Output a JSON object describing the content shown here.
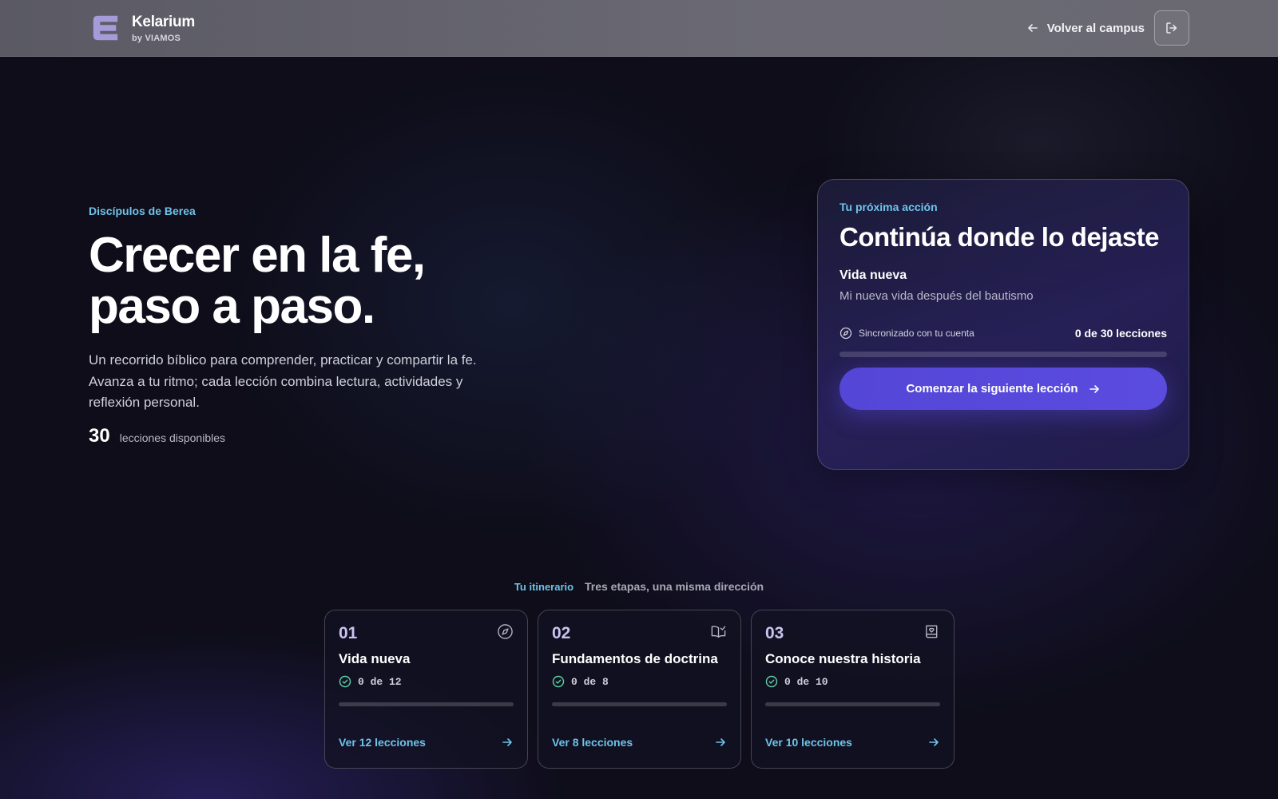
{
  "header": {
    "app_name": "Kelarium",
    "by_line": "by VIAMOS",
    "back_label": "Volver al campus",
    "logo_icon": "kelarium-logo",
    "logout_icon": "logout-icon"
  },
  "hero": {
    "eyebrow": "Discípulos de Berea",
    "title_line1": "Crecer en la fe,",
    "title_line2": "paso a paso.",
    "description": "Un recorrido bíblico para comprender, practicar y compartir la fe. Avanza a tu ritmo; cada lección combina lectura, actividades y reflexión personal.",
    "lessons_count": "30",
    "lessons_label": "lecciones disponibles"
  },
  "next_action": {
    "eyebrow": "Tu próxima acción",
    "title": "Continúa donde lo dejaste",
    "course_title": "Vida nueva",
    "course_subtitle": "Mi nueva vida después del bautismo",
    "sync_label": "Sincronizado con tu cuenta",
    "progress_label": "0 de 30 lecciones",
    "progress_fraction": 0,
    "cta_label": "Comenzar la siguiente lección"
  },
  "itinerary": {
    "label": "Tu itinerario",
    "subtitle": "Tres etapas, una misma dirección",
    "stages": [
      {
        "number": "01",
        "title": "Vida nueva",
        "count": "0 de 12",
        "progress_fraction": 0,
        "link": "Ver 12 lecciones",
        "icon": "compass-icon"
      },
      {
        "number": "02",
        "title": "Fundamentos de doctrina",
        "count": "0 de 8",
        "progress_fraction": 0,
        "link": "Ver 8 lecciones",
        "icon": "book-check-icon"
      },
      {
        "number": "03",
        "title": "Conoce nuestra historia",
        "count": "0 de 10",
        "progress_fraction": 0,
        "link": "Ver 10 lecciones",
        "icon": "book-heart-icon"
      }
    ]
  },
  "colors": {
    "accent_cyan": "#6fc3ea",
    "primary_violet": "#5446d6",
    "background": "#0e0d19"
  }
}
